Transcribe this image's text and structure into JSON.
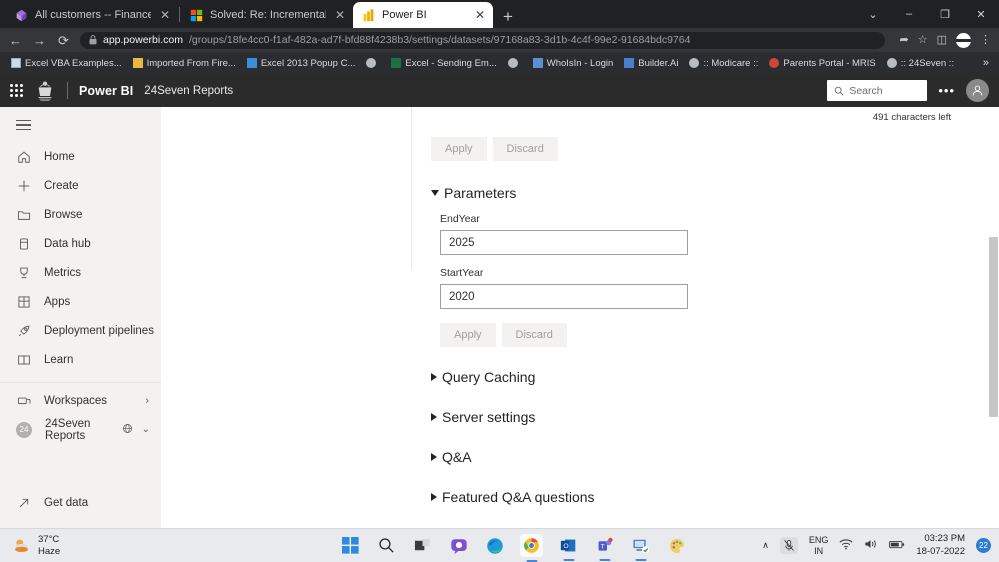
{
  "browser": {
    "tabs": [
      {
        "title": "All customers -- Finance and Op",
        "favicon": "dynamics-icon",
        "active": false,
        "close_label": "✕"
      },
      {
        "title": "Solved: Re: Incremental Refresh",
        "favicon": "microsoft-icon",
        "active": false,
        "close_label": "✕"
      },
      {
        "title": "Power BI",
        "favicon": "powerbi-icon",
        "active": true,
        "close_label": "✕"
      }
    ],
    "new_tab_label": "+",
    "window_controls": {
      "minimize_more": "⌄",
      "minimize": "–",
      "maximize": "❐",
      "close": "✕"
    },
    "nav": {
      "back": "←",
      "forward": "→",
      "reload": "⟳"
    },
    "url": {
      "lock": "lock-icon",
      "host": "app.powerbi.com",
      "path": "/groups/18fe4cc0-f1af-482a-ad7f-bfd88f4238b3/settings/datasets/97168a83-3d1b-4c4f-99e2-91684bdc9764"
    },
    "omni_icons": {
      "share": "➦",
      "bookmark": "☆",
      "sidepanel": "◫",
      "menu": "⋮"
    },
    "bookmarks": [
      {
        "label": "Excel VBA Examples...",
        "icon": "book-icon"
      },
      {
        "label": "Imported From Fire...",
        "icon": "folder-icon"
      },
      {
        "label": "Excel 2013 Popup C...",
        "icon": "blue-doc-icon"
      },
      {
        "label": "",
        "icon": "globe-icon"
      },
      {
        "label": "Excel - Sending Em...",
        "icon": "excel-icon"
      },
      {
        "label": "",
        "icon": "globe-icon"
      },
      {
        "label": "WhoIsIn - Login",
        "icon": "blue-book-icon"
      },
      {
        "label": "Builder.Ai",
        "icon": "blue-doc-icon"
      },
      {
        "label": "",
        "icon": "globe-icon"
      },
      {
        "label": ":: Modicare ::",
        "icon": "none"
      },
      {
        "label": "Parents Portal - MRIS",
        "icon": "red-flower-icon"
      },
      {
        "label": "",
        "icon": "globe-icon"
      },
      {
        "label": ":: 24Seven ::",
        "icon": "none"
      }
    ],
    "bookmarks_overflow": "»"
  },
  "powerbi_header": {
    "waffle": "app-launcher-icon",
    "logo": "crest-logo",
    "brand": "Power BI",
    "workspace": "24Seven Reports",
    "search_placeholder": "Search",
    "search_icon": "search-icon",
    "more": "•••",
    "avatar": "user-avatar-icon"
  },
  "sidebar": {
    "hamburger": "hamburger-icon",
    "items": [
      {
        "label": "Home",
        "icon": "home-icon"
      },
      {
        "label": "Create",
        "icon": "plus-icon"
      },
      {
        "label": "Browse",
        "icon": "folder-icon"
      },
      {
        "label": "Data hub",
        "icon": "database-icon"
      },
      {
        "label": "Metrics",
        "icon": "trophy-icon"
      },
      {
        "label": "Apps",
        "icon": "apps-grid-icon"
      },
      {
        "label": "Deployment pipelines",
        "icon": "rocket-icon"
      },
      {
        "label": "Learn",
        "icon": "book-icon"
      }
    ],
    "workspaces": {
      "label": "Workspaces",
      "icon": "workspaces-icon",
      "chevron": "›"
    },
    "current_workspace": {
      "label": "24Seven Reports",
      "avatar_letter": "24",
      "globe_icon": "shared-globe-icon",
      "chevron": "⌄"
    },
    "get_data": {
      "label": "Get data",
      "icon": "arrow-up-right-icon"
    }
  },
  "main": {
    "description_textarea": {
      "value": "",
      "placeholder": ""
    },
    "char_counter": "491 characters left",
    "description_apply": "Apply",
    "description_discard": "Discard",
    "parameters": {
      "title": "Parameters",
      "expanded": true,
      "fields": [
        {
          "label": "EndYear",
          "value": "2025"
        },
        {
          "label": "StartYear",
          "value": "2020"
        }
      ],
      "apply": "Apply",
      "discard": "Discard"
    },
    "collapsed_sections": [
      {
        "label": "Query Caching"
      },
      {
        "label": "Server settings"
      },
      {
        "label": "Q&A"
      },
      {
        "label": "Featured Q&A questions"
      }
    ]
  },
  "taskbar": {
    "weather": {
      "temperature": "37°C",
      "condition": "Haze",
      "icon": "haze-icon"
    },
    "apps": [
      {
        "name": "start-button",
        "icon": "windows-logo-icon",
        "running": false
      },
      {
        "name": "search",
        "icon": "search-icon",
        "running": false
      },
      {
        "name": "task-view",
        "icon": "task-view-icon",
        "running": false
      },
      {
        "name": "teams-chat",
        "icon": "chat-icon",
        "running": false
      },
      {
        "name": "edge",
        "icon": "edge-icon",
        "running": false
      },
      {
        "name": "chrome",
        "icon": "chrome-icon",
        "running": true
      },
      {
        "name": "outlook",
        "icon": "outlook-icon",
        "running": true
      },
      {
        "name": "teams",
        "icon": "teams-icon",
        "running": true
      },
      {
        "name": "remote-desktop",
        "icon": "remote-desktop-icon",
        "running": true
      },
      {
        "name": "paint",
        "icon": "paint-icon",
        "running": false
      }
    ],
    "tray": {
      "overflow": "∧",
      "mic": "mic-muted-icon",
      "language_line1": "ENG",
      "language_line2": "IN",
      "wifi": "wifi-icon",
      "volume": "volume-icon",
      "battery": "battery-icon",
      "time": "03:23 PM",
      "date": "18-07-2022",
      "notification_count": "22"
    }
  },
  "colors": {
    "chrome_dark": "#202124",
    "pbi_header": "#2b2b2b",
    "sidebar_bg": "#f3f2f1",
    "accent_blue": "#2b7cd3",
    "powerbi_yellow": "#e8bc2e"
  }
}
